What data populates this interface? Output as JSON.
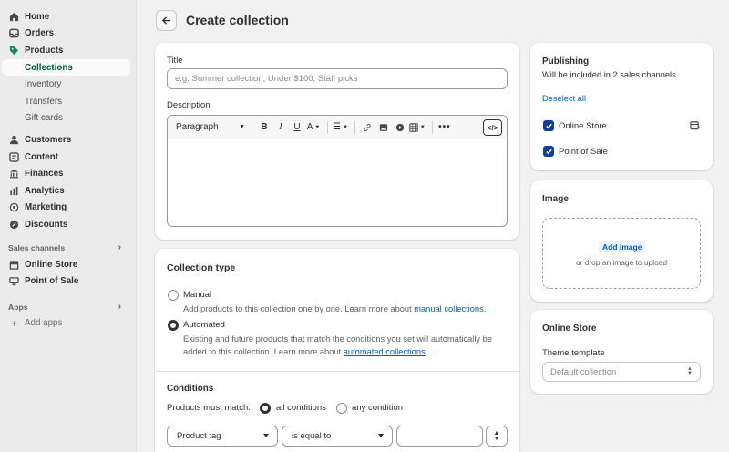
{
  "sidebar": {
    "items": [
      {
        "label": "Home",
        "icon": "home-icon"
      },
      {
        "label": "Orders",
        "icon": "inbox-icon"
      },
      {
        "label": "Products",
        "icon": "tag-icon"
      }
    ],
    "product_sub": [
      "Collections",
      "Inventory",
      "Transfers",
      "Gift cards"
    ],
    "items2": [
      {
        "label": "Customers",
        "icon": "person-icon"
      },
      {
        "label": "Content",
        "icon": "content-icon"
      },
      {
        "label": "Finances",
        "icon": "bank-icon"
      },
      {
        "label": "Analytics",
        "icon": "chart-icon"
      },
      {
        "label": "Marketing",
        "icon": "target-icon"
      },
      {
        "label": "Discounts",
        "icon": "discount-icon"
      }
    ],
    "sales_channels_title": "Sales channels",
    "channels": [
      {
        "label": "Online Store",
        "icon": "store-icon"
      },
      {
        "label": "Point of Sale",
        "icon": "pos-icon"
      }
    ],
    "apps_title": "Apps",
    "add_apps": "Add apps"
  },
  "header": {
    "title": "Create collection"
  },
  "title_card": {
    "title_label": "Title",
    "title_placeholder": "e.g. Summer collection, Under $100, Staff picks",
    "description_label": "Description",
    "paragraph_select": "Paragraph"
  },
  "collection_type": {
    "title": "Collection type",
    "manual_label": "Manual",
    "manual_desc": "Add products to this collection one by one. Learn more about ",
    "manual_link": "manual collections",
    "manual_suffix": ".",
    "automated_label": "Automated",
    "automated_desc": "Existing and future products that match the conditions you set will automatically be added to this collection. Learn more about ",
    "automated_link": "automated collections",
    "automated_suffix": ".",
    "selected": "Automated"
  },
  "conditions": {
    "title": "Conditions",
    "match_label": "Products must match:",
    "all_label": "all conditions",
    "any_label": "any condition",
    "selected": "all conditions",
    "field": "Product tag",
    "operator": "is equal to",
    "value": ""
  },
  "publishing": {
    "title": "Publishing",
    "subtitle": "Will be included in 2 sales channels",
    "deselect_all": "Deselect all",
    "channels": [
      {
        "label": "Online Store",
        "checked": true
      },
      {
        "label": "Point of Sale",
        "checked": true
      }
    ]
  },
  "image_card": {
    "title": "Image",
    "add_image": "Add image",
    "drop_text": "or drop an image to upload"
  },
  "online_store_card": {
    "title": "Online Store",
    "theme_label": "Theme template",
    "theme_value": "Default collection"
  },
  "colors": {
    "accent_green": "#005e46",
    "link_blue": "#005bd3",
    "checkbox_blue": "#0f3f9a"
  }
}
